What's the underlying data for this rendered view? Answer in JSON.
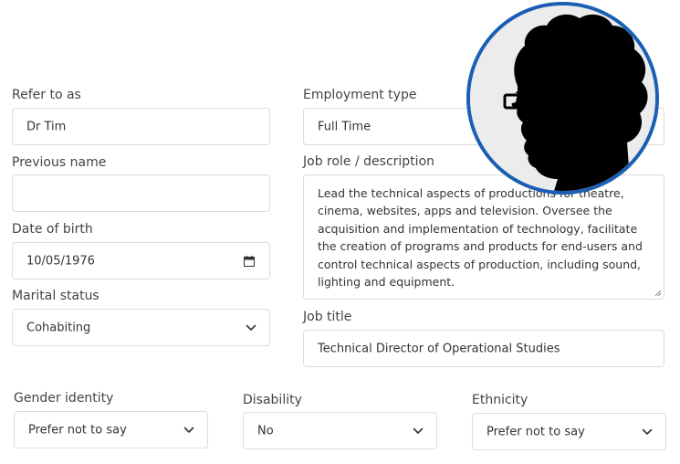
{
  "left": {
    "refer_to_as": {
      "label": "Refer to as",
      "value": "Dr Tim"
    },
    "previous_name": {
      "label": "Previous name",
      "value": ""
    },
    "date_of_birth": {
      "label": "Date of birth",
      "value": "10/05/1976"
    },
    "marital_status": {
      "label": "Marital status",
      "value": "Cohabiting"
    }
  },
  "right": {
    "employment_type": {
      "label": "Employment type",
      "value": "Full Time"
    },
    "job_role": {
      "label": "Job role / description",
      "value": "Lead the technical aspects of productions for theatre, cinema, websites, apps and television. Oversee the acquisition and implementation of technology, facilitate the creation of programs and products for end-users and control technical aspects of production, including sound, lighting and equipment."
    },
    "job_title": {
      "label": "Job title",
      "value": "Technical Director of Operational Studies"
    }
  },
  "bottom": {
    "gender_identity": {
      "label": "Gender identity",
      "value": "Prefer not to say"
    },
    "disability": {
      "label": "Disability",
      "value": "No"
    },
    "ethnicity": {
      "label": "Ethnicity",
      "value": "Prefer not to say"
    }
  },
  "colors": {
    "avatar_border": "#1a5fb4",
    "field_border": "#dcdcdc",
    "label_text": "#444444",
    "value_text": "#333333"
  },
  "icons": [
    "chevron-down-icon",
    "calendar-icon",
    "resize-handle-icon"
  ]
}
